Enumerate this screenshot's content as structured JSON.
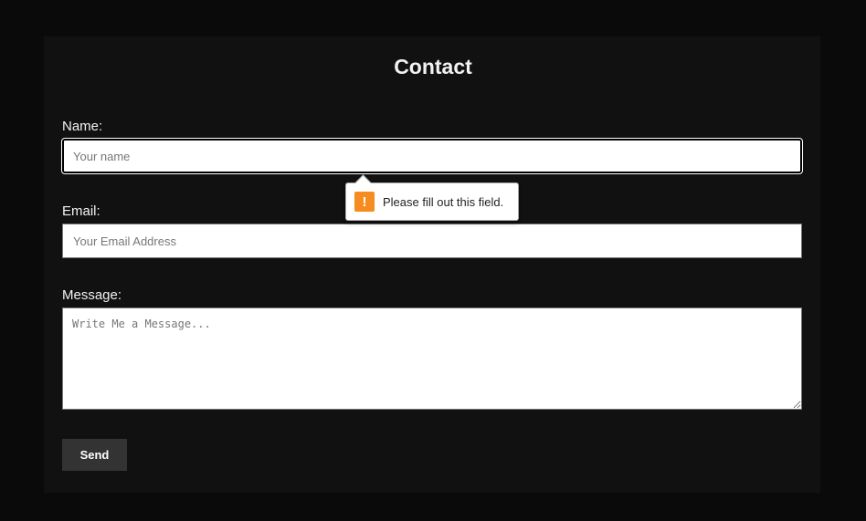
{
  "title": "Contact",
  "form": {
    "name_label": "Name:",
    "name_placeholder": "Your name",
    "email_label": "Email:",
    "email_placeholder": "Your Email Address",
    "message_label": "Message:",
    "message_placeholder": "Write Me a Message...",
    "send_label": "Send"
  },
  "validation": {
    "message": "Please fill out this field.",
    "icon": "warning-icon",
    "icon_glyph": "!",
    "color": "#f68c1f"
  }
}
